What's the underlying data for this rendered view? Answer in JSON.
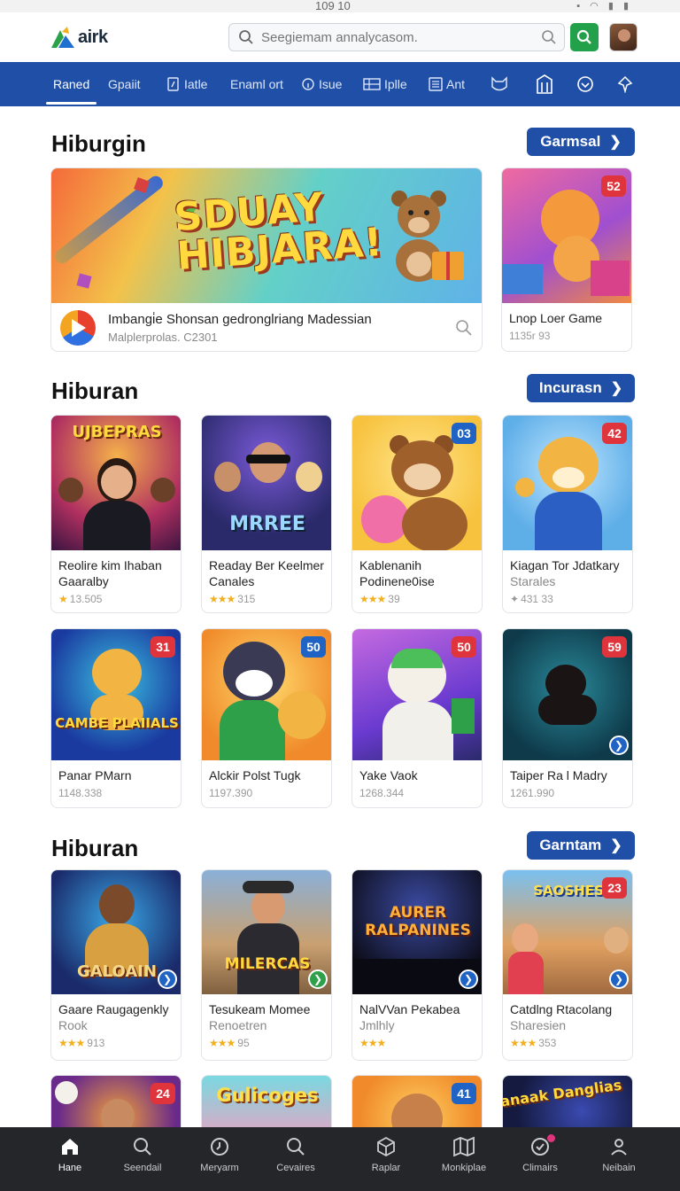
{
  "status_bar": {
    "time": "109 10",
    "icons": "▪ ◠ ▮ ▮"
  },
  "header": {
    "logo_text": "airk",
    "search_placeholder": "Seegiemam annalycasom.",
    "search_value": ""
  },
  "nav": {
    "items": [
      {
        "label": "Raned",
        "icon": ""
      },
      {
        "label": "Gpaiit",
        "icon": ""
      },
      {
        "label": "Iatle",
        "icon": "tag-icon"
      },
      {
        "label": "Enaml ort",
        "icon": ""
      },
      {
        "label": "Isue",
        "icon": "info-icon"
      },
      {
        "label": "Iplle",
        "icon": "grid-icon"
      },
      {
        "label": "Ant",
        "icon": "list-icon"
      }
    ],
    "icon_items": [
      "cat-icon",
      "building-icon",
      "smile-icon",
      "pin-icon"
    ]
  },
  "sections": [
    {
      "title": "Hiburgin",
      "button": "Garmsal"
    },
    {
      "title": "Hiburan",
      "button": "Incurasn"
    },
    {
      "title": "Hiburan",
      "button": "Garntam"
    }
  ],
  "featured": {
    "banner_title_line1": "SDUAY",
    "banner_title_line2": "HIBJARA!",
    "name": "Imbangi̇e Shonsan gedronglriang Madessian",
    "sub": "Malplerprolas.  C2301",
    "side_card": {
      "badge": "52",
      "title": "Lnop Loer Game",
      "meta": "1135r 93"
    }
  },
  "row1": [
    {
      "caption": "UJBEPRAS",
      "title1": "Reolire kim Ihaban",
      "title2": "Gaaralby",
      "stars": "★",
      "meta": "13.505",
      "badge": ""
    },
    {
      "caption": "MRREE",
      "title1": "Readay Ber Keelmer",
      "title2": "Canales",
      "stars": "★★★",
      "meta": "315",
      "badge": ""
    },
    {
      "caption": "",
      "title1": "Kablenanih",
      "title2": "Podinene0ise",
      "stars": "★★★",
      "meta": "39",
      "badge": "03"
    },
    {
      "caption": "",
      "title1": "Kiagan Tor Jdatkary",
      "title2": "Starales",
      "stars": "✦",
      "meta": "431 33",
      "badge": "42"
    }
  ],
  "row2": [
    {
      "caption": "CAMBE PLAIIALS",
      "title1": "Panar PMarn",
      "meta": "1148.338",
      "badge": "31"
    },
    {
      "caption": "",
      "title1": "Alckir Polst Tugk",
      "meta": "1197.390",
      "badge": "50"
    },
    {
      "caption": "",
      "title1": "Yake Vaok",
      "meta": "1268.344",
      "badge": "50"
    },
    {
      "caption": "",
      "title1": "Taiper Ra l Madry",
      "meta": "1261.990",
      "badge": "59"
    }
  ],
  "row3": [
    {
      "caption": "GALOAIN",
      "title1": "Gaare Raugagenkly",
      "title2": "Rook",
      "stars": "★★★",
      "meta": "913",
      "badge": ""
    },
    {
      "caption": "MILERCAS",
      "title1": "Tesukeam Momee",
      "title2": "Renoetren",
      "stars": "★★★",
      "meta": "95",
      "badge": ""
    },
    {
      "caption": "AURER RALPANINES",
      "title1": "NalVVan Pekabea",
      "title2": "Jmlhly",
      "stars": "★★★",
      "meta": "",
      "badge": ""
    },
    {
      "caption": "SAOSHES",
      "title1": "Catdlng Rtacolang",
      "title2": "Sharesien",
      "stars": "★★★",
      "meta": "353",
      "badge": "23"
    }
  ],
  "row4": [
    {
      "caption": "",
      "badge": "24"
    },
    {
      "caption": "Gulicoges",
      "badge": ""
    },
    {
      "caption": "",
      "badge": "41"
    },
    {
      "caption": "Hanaak Danglias",
      "badge": ""
    }
  ],
  "bottom_tabs": [
    {
      "label": "Hane",
      "icon": "home-icon"
    },
    {
      "label": "Seendail",
      "icon": "search-icon"
    },
    {
      "label": "Meryarm",
      "icon": "clock-icon"
    },
    {
      "label": "Cevaires",
      "icon": "search-icon"
    },
    {
      "label": "Raplar",
      "icon": "cube-icon"
    },
    {
      "label": "Monkiplae",
      "icon": "map-icon"
    },
    {
      "label": "Climairs",
      "icon": "check-circle-icon"
    },
    {
      "label": "Neibain",
      "icon": "user-icon"
    }
  ],
  "colors": {
    "nav": "#1f4fa6",
    "accent_green": "#22a14a",
    "badge_red": "#e0343c",
    "badge_blue": "#1f63c4",
    "bottom_bar": "#242629"
  }
}
